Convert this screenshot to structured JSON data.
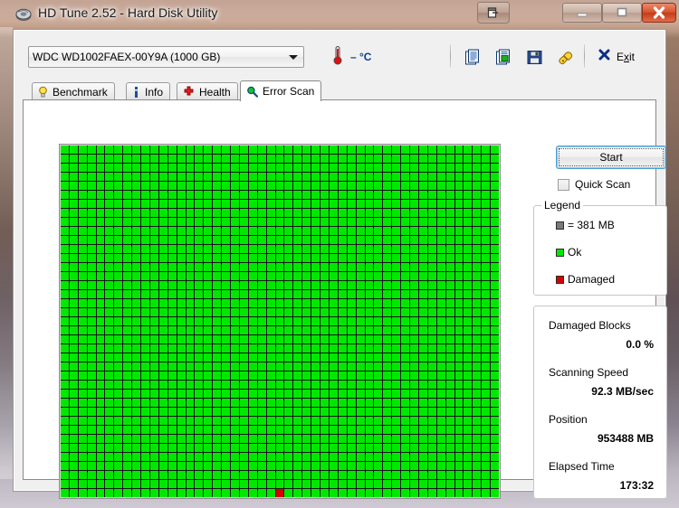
{
  "window": {
    "title": "HD Tune 2.52 - Hard Disk Utility",
    "app_icon": "hard-disk-icon",
    "controls": {
      "extra_label": "⮐",
      "minimize_label": "–",
      "maximize_label": "□",
      "close_label": "✕"
    }
  },
  "toolbar": {
    "drive": {
      "selected": "WDC WD1002FAEX-00Y9A (1000 GB)",
      "options": [
        "WDC WD1002FAEX-00Y9A (1000 GB)"
      ]
    },
    "temperature": {
      "icon": "thermometer-icon",
      "value": "– °C",
      "color": "#0a3d91"
    },
    "buttons": [
      {
        "name": "copy-text-icon",
        "tooltip": "Copy text"
      },
      {
        "name": "copy-image-icon",
        "tooltip": "Copy screenshot"
      },
      {
        "name": "save-icon",
        "tooltip": "Save"
      },
      {
        "name": "options-icon",
        "tooltip": "Options"
      }
    ],
    "exit": {
      "icon": "close-x-icon",
      "label_pre": "E",
      "label_accel": "x",
      "label_post": "it"
    }
  },
  "tabs": [
    {
      "label": "Benchmark",
      "icon": "lightbulb-icon",
      "active": false
    },
    {
      "label": "Info",
      "icon": "info-icon",
      "active": false
    },
    {
      "label": "Health",
      "icon": "red-cross-icon",
      "active": false
    },
    {
      "label": "Error Scan",
      "icon": "magnifier-icon",
      "active": true
    }
  ],
  "error_scan": {
    "start_button": "Start",
    "quick_scan": {
      "label": "Quick Scan",
      "checked": false
    },
    "legend": {
      "title": "Legend",
      "block_size": "= 381 MB",
      "ok_label": "Ok",
      "damaged_label": "Damaged",
      "block_color": "#7a7a7a",
      "ok_color": "#00e800",
      "damaged_color": "#d80000"
    },
    "stats": [
      {
        "label": "Damaged Blocks",
        "value": "0.0 %"
      },
      {
        "label": "Scanning Speed",
        "value": "92.3 MB/sec"
      },
      {
        "label": "Position",
        "value": "953488 MB"
      },
      {
        "label": "Elapsed Time",
        "value": "173:32"
      }
    ],
    "grid": {
      "columns": 49,
      "rows": 39,
      "damaged_cells": [
        {
          "col": 24,
          "row": 38
        }
      ],
      "ok_color": "#00e800",
      "damaged_color": "#d80000",
      "line_color": "#141414"
    }
  }
}
